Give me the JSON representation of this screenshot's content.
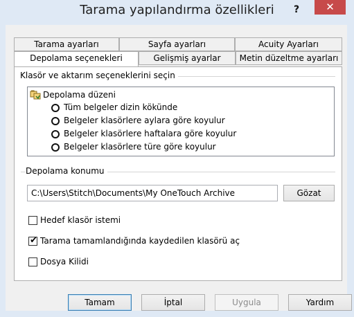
{
  "window": {
    "title": "Tarama yapılandırma özellikleri",
    "help_glyph": "?",
    "close_glyph": "✕"
  },
  "tabs": {
    "row1": [
      "Tarama ayarları",
      "Sayfa ayarları",
      "Acuity Ayarları"
    ],
    "row2": [
      "Depolama seçenekleri",
      "Gelişmiş ayarlar",
      "Metin düzeltme ayarları"
    ],
    "active": "Depolama seçenekleri"
  },
  "folder_group": {
    "label": "Klasör ve aktarım seçeneklerini seçin",
    "root_label": "Depolama düzeni",
    "root_icon": "folder-tree-icon",
    "options": [
      "Tüm belgeler dizin kökünde",
      "Belgeler klasörlere aylara göre koyulur",
      "Belgeler klasörlere haftalara göre koyulur",
      "Belgeler klasörlere türe göre koyulur"
    ]
  },
  "location": {
    "label": "Depolama konumu",
    "path": "C:\\Users\\Stitch\\Documents\\My OneTouch Archive",
    "browse_label": "Gözat"
  },
  "checkboxes": {
    "target_prompt": {
      "label": "Hedef klasör istemi",
      "checked": false
    },
    "open_folder": {
      "label": "Tarama tamamlandığında kaydedilen klasörü aç",
      "checked": true,
      "check_glyph": "✔"
    },
    "file_lock": {
      "label": "Dosya Kilidi",
      "checked": false
    }
  },
  "buttons": {
    "ok": "Tamam",
    "cancel": "İptal",
    "apply": "Uygula",
    "help": "Yardım"
  },
  "colors": {
    "close_button": "#c74a4a",
    "frame": "#dfe9f5",
    "default_button_border": "#3c7fb1"
  }
}
